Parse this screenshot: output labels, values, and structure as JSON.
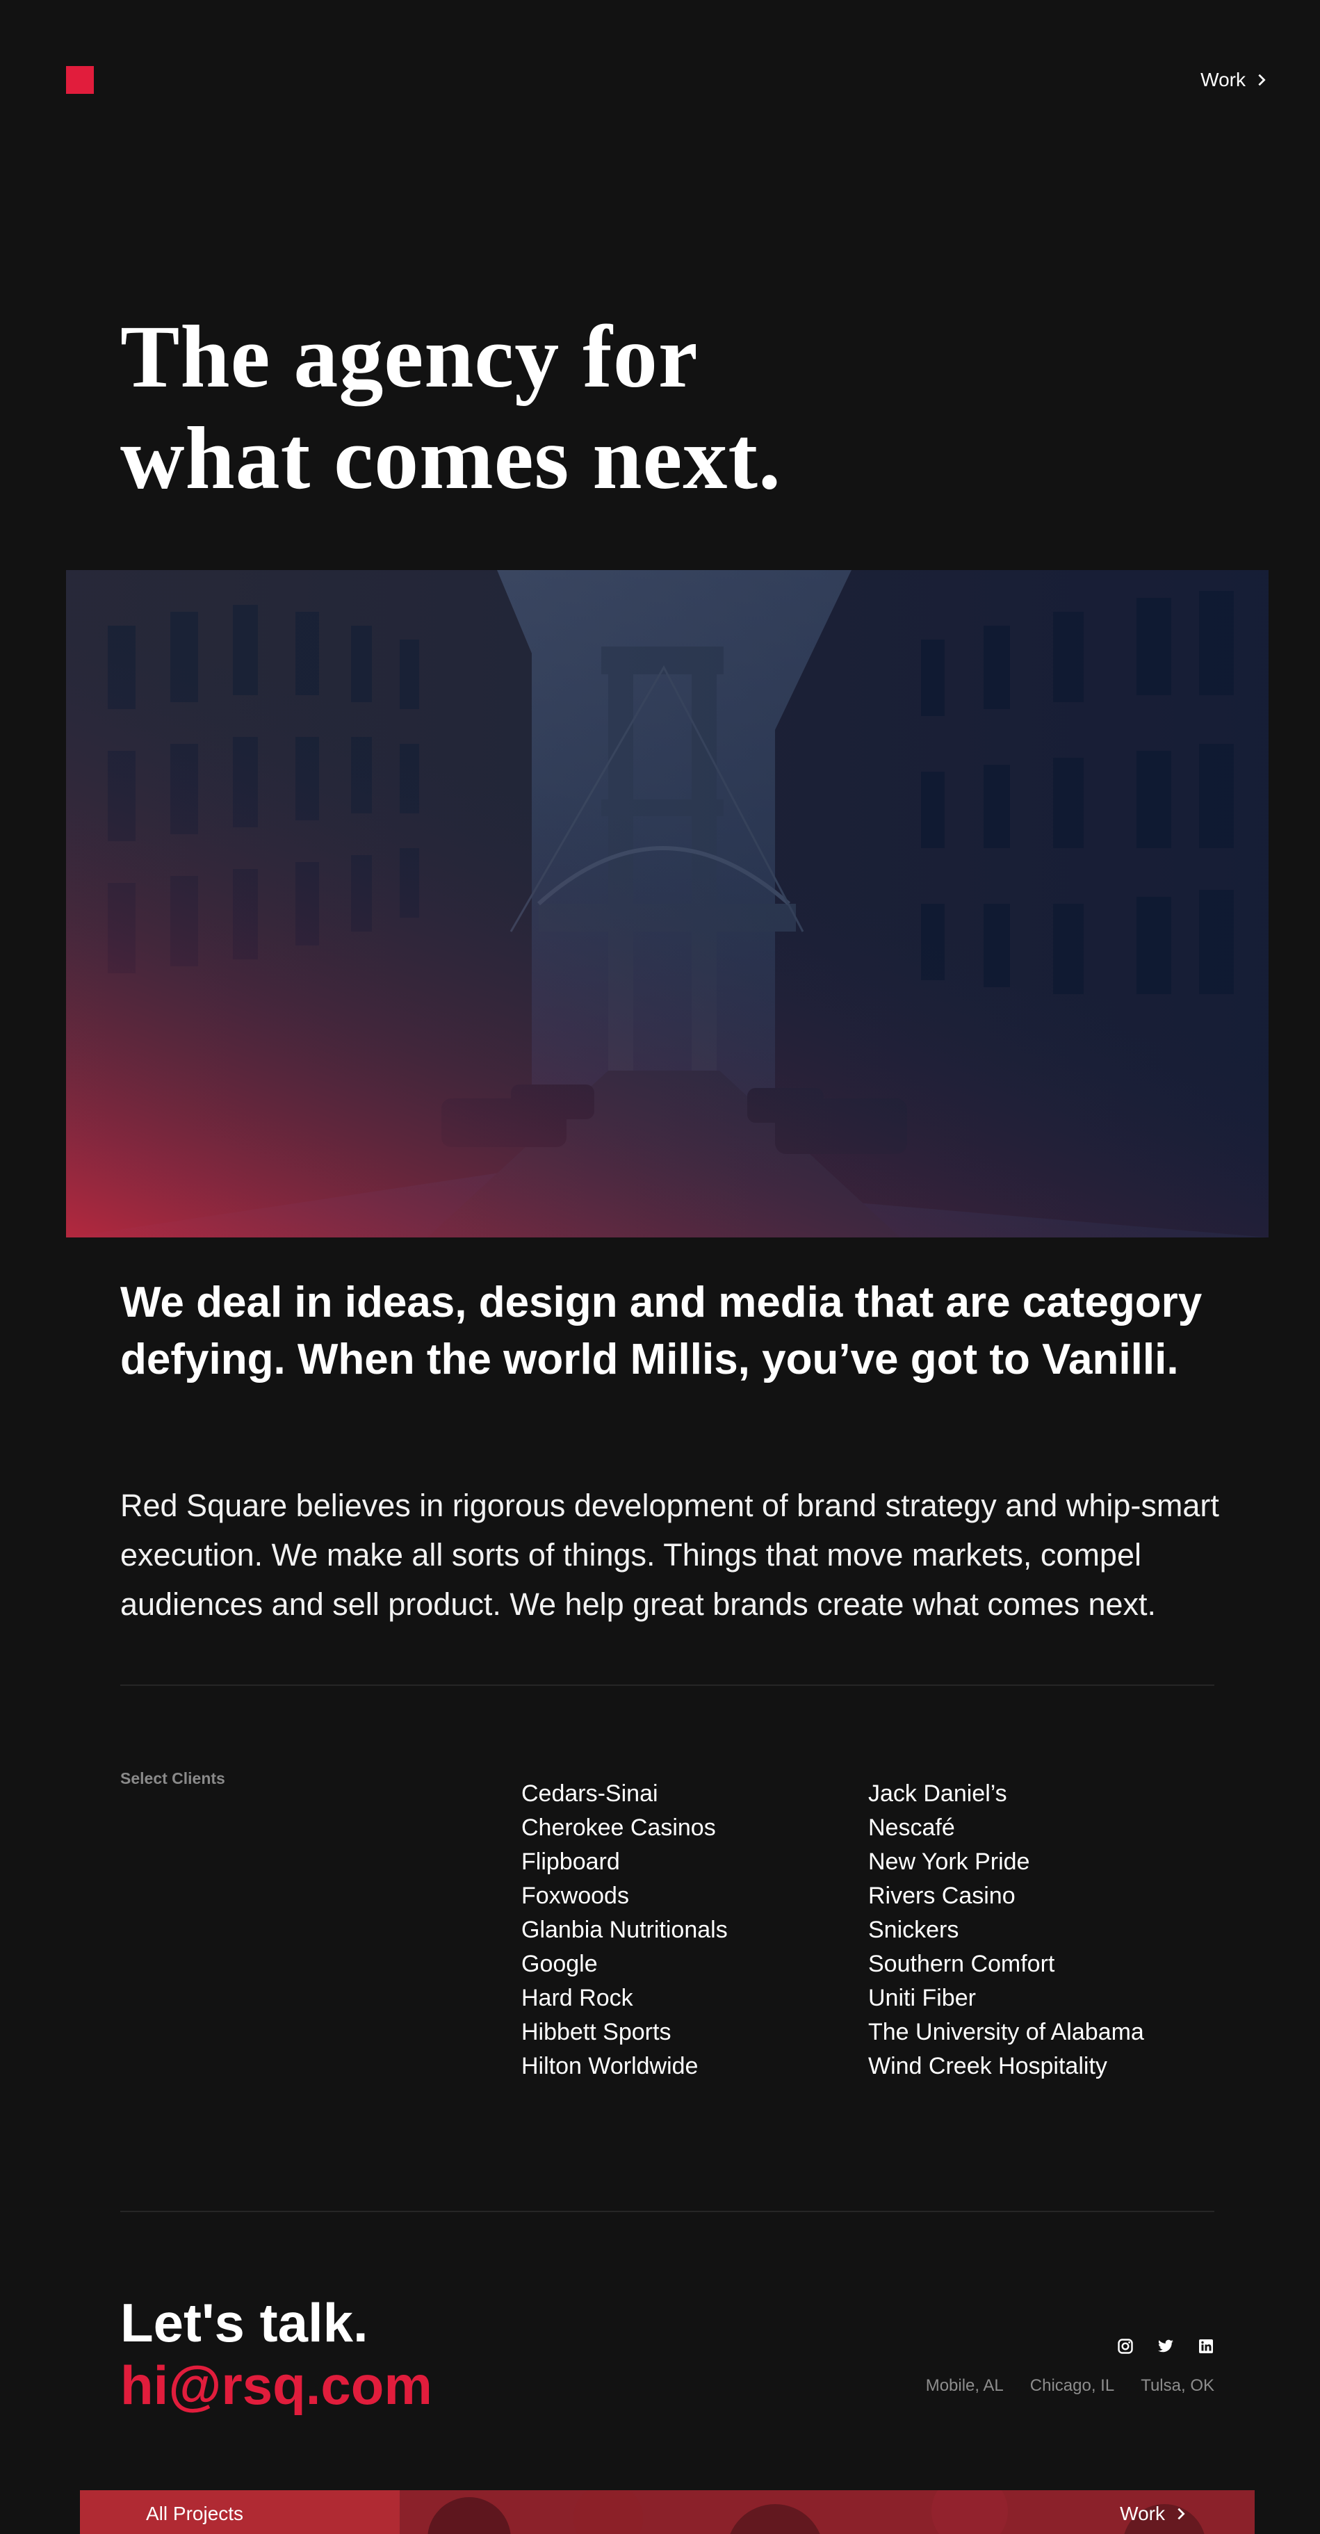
{
  "header": {
    "nav_work_label": "Work"
  },
  "hero": {
    "title_line1": "The agency for",
    "title_line2": "what comes next."
  },
  "intro": {
    "lead": "We deal in ideas, design and media that are category defying. When the world Millis, you’ve got to Vanilli.",
    "body": "Red Square believes in rigorous development of brand strategy and whip-smart execution. We make all sorts of things. Things that move markets, compel audiences and sell product. We help great brands create what comes next."
  },
  "clients": {
    "label": "Select Clients",
    "column_a": [
      "Cedars-Sinai",
      "Cherokee Casinos",
      "Flipboard",
      "Foxwoods",
      "Glanbia Nutritionals",
      "Google",
      "Hard Rock",
      "Hibbett Sports",
      "Hilton Worldwide"
    ],
    "column_b": [
      "Jack Daniel’s",
      "Nescafé",
      "New York Pride",
      "Rivers Casino",
      "Snickers",
      "Southern Comfort",
      "Uniti Fiber",
      "The University of Alabama",
      "Wind Creek Hospitality"
    ]
  },
  "contact": {
    "heading": "Let's talk.",
    "email": "hi@rsq.com",
    "social_icons": [
      "instagram-icon",
      "twitter-icon",
      "linkedin-icon"
    ],
    "locations": [
      "Mobile, AL",
      "Chicago, IL",
      "Tulsa, OK"
    ]
  },
  "next_card": {
    "left_label": "All Projects",
    "right_label": "Work"
  },
  "colors": {
    "background": "#121212",
    "accent": "#e11d3c",
    "muted": "#8d8d8d"
  }
}
